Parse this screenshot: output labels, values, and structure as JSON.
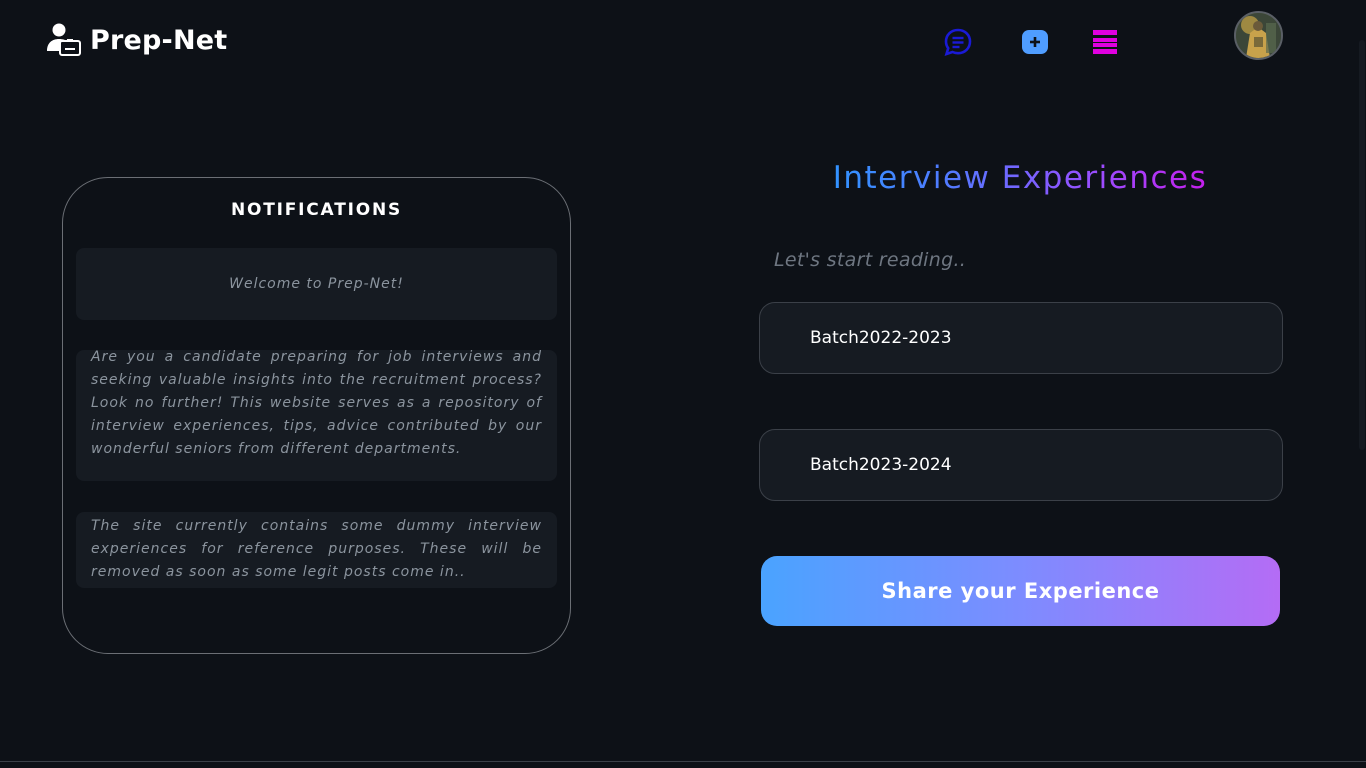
{
  "header": {
    "brand_name": "Prep-Net",
    "brand_icon": "user-with-id-card-icon",
    "nav_icons": [
      "chat-bubble-icon",
      "plus-square-icon",
      "stack-menu-icon"
    ],
    "nav_colors": {
      "chat": "#1a1ad6",
      "add": "#4f9dff",
      "menu": "#e000e0"
    }
  },
  "notifications": {
    "title": "NOTIFICATIONS",
    "items": [
      "Welcome to Prep-Net!",
      "Are you a candidate preparing for job interviews and seeking valuable insights into the recruitment process? Look no further! This website serves as a repository of interview experiences, tips, advice contributed by our wonderful seniors from different departments.",
      "The site currently contains some dummy interview experiences for reference purposes. These will be removed as soon as some legit posts come in.."
    ]
  },
  "main": {
    "heading": "Interview Experiences",
    "tagline": "Let's start reading..",
    "batches": [
      "Batch2022-2023",
      "Batch2023-2024"
    ],
    "share_label": "Share your Experience"
  },
  "colors": {
    "background": "#0d1117",
    "card": "#161b22",
    "heading_gradient": [
      "#1fa2ff",
      "#e000e0"
    ],
    "button_gradient": [
      "#4aa3ff",
      "#b46cf5"
    ]
  }
}
